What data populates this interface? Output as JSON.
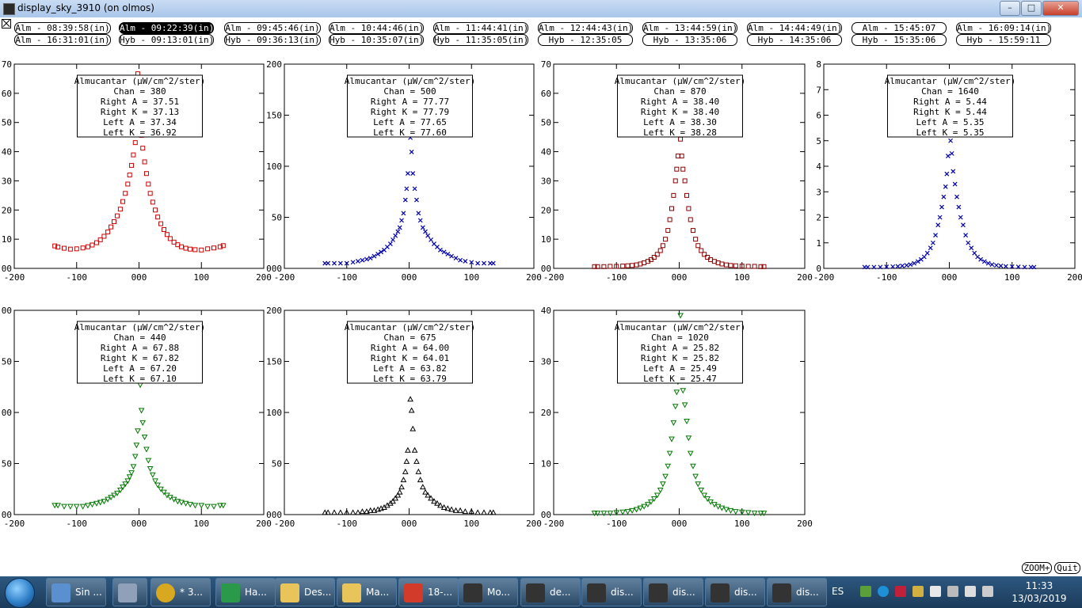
{
  "window": {
    "title": "display_sky_3910 (on olmos)"
  },
  "time_buttons": [
    [
      "Alm - 08:39:58(in)",
      "Alm - 09:22:39(in)",
      "Alm - 09:45:46(in)",
      "Alm - 10:44:46(in)",
      "Alm - 11:44:41(in)",
      "Alm - 12:44:43(in)",
      "Alm - 13:44:59(in)",
      "Alm - 14:44:49(in)",
      "Alm - 15:45:07",
      "Alm - 16:09:14(in)"
    ],
    [
      "Alm - 16:31:01(in)",
      "Hyb - 09:13:01(in)",
      "Hyb - 09:36:13(in)",
      "Hyb - 10:35:07(in)",
      "Hyb - 11:35:05(in)",
      "Hyb - 12:35:05",
      "Hyb - 13:35:06",
      "Hyb - 14:35:06",
      "Hyb - 15:35:06",
      "Hyb - 15:59:11"
    ]
  ],
  "selected_button": "Alm - 09:22:39(in)",
  "bottom_buttons": {
    "zoom": "ZOOM+",
    "quit": "Quit"
  },
  "colors": {
    "red": "#cc0000",
    "blue": "#0000aa",
    "darkred": "#8b0000",
    "green": "#007700",
    "black": "#000000"
  },
  "chart_data": [
    {
      "type": "scatter",
      "marker": "square",
      "color": "#cc0000",
      "xlim": [
        -200,
        200
      ],
      "ylim": [
        0,
        70
      ],
      "yticks": [
        "00",
        "10",
        "20",
        "30",
        "40",
        "50",
        "60",
        "70"
      ],
      "xticks": [
        "-200",
        "-100",
        "000",
        "100",
        "200"
      ],
      "legend": [
        "Almucantar (µW/cm^2/ster)",
        "Chan = 380",
        "Right A = 37.51",
        "Right K = 37.13",
        "Left A = 37.34",
        "Left K = 36.92"
      ],
      "x": [
        -135,
        -130,
        -120,
        -110,
        -100,
        -90,
        -82,
        -75,
        -68,
        -62,
        -56,
        -50,
        -45,
        -40,
        -35,
        -30,
        -26,
        -22,
        -18,
        -15,
        -12,
        -9,
        -6,
        -4,
        -2,
        2,
        4,
        6,
        9,
        12,
        15,
        18,
        22,
        26,
        30,
        35,
        40,
        45,
        50,
        56,
        62,
        68,
        75,
        82,
        90,
        100,
        110,
        120,
        130,
        135
      ],
      "y": [
        7.7,
        7.3,
        6.9,
        6.6,
        6.7,
        7.0,
        7.4,
        8.0,
        8.8,
        9.8,
        11.0,
        12.5,
        14.2,
        16.0,
        18.0,
        20.3,
        22.9,
        25.7,
        28.9,
        32.0,
        35.3,
        38.9,
        43.1,
        49.0,
        66.7,
        64.5,
        45.6,
        41.2,
        36.5,
        32.5,
        28.9,
        25.7,
        22.7,
        20.0,
        17.6,
        15.3,
        13.3,
        11.6,
        10.2,
        9.0,
        8.1,
        7.4,
        6.9,
        6.6,
        6.4,
        6.3,
        6.7,
        7.0,
        7.4,
        7.8
      ]
    },
    {
      "type": "scatter",
      "marker": "x",
      "color": "#0000aa",
      "xlim": [
        -200,
        200
      ],
      "ylim": [
        0,
        200
      ],
      "yticks": [
        "000",
        "50",
        "100",
        "150",
        "200"
      ],
      "xticks": [
        "-200",
        "-100",
        "000",
        "100",
        "200"
      ],
      "legend": [
        "Almucantar (µW/cm^2/ster)",
        "Chan = 500",
        "Right A = 77.77",
        "Right K = 77.79",
        "Left A = 77.65",
        "Left K = 77.60"
      ],
      "x": [
        -135,
        -130,
        -120,
        -110,
        -100,
        -90,
        -82,
        -75,
        -68,
        -62,
        -56,
        -50,
        -45,
        -40,
        -35,
        -30,
        -26,
        -22,
        -18,
        -15,
        -12,
        -9,
        -6,
        -4,
        -2,
        2,
        4,
        6,
        9,
        12,
        15,
        18,
        22,
        26,
        30,
        35,
        40,
        45,
        50,
        56,
        62,
        68,
        75,
        82,
        90,
        100,
        110,
        120,
        130,
        135
      ],
      "y": [
        5,
        5,
        5,
        5,
        5,
        6,
        7,
        8,
        9,
        10,
        12,
        14,
        16,
        18,
        21,
        24,
        28,
        32,
        36,
        40,
        47,
        54,
        67,
        78,
        93,
        128,
        114,
        93,
        78,
        67,
        54,
        47,
        40,
        36,
        32,
        28,
        24,
        21,
        18,
        16,
        14,
        12,
        10,
        8,
        7,
        6,
        5,
        5,
        5,
        5
      ]
    },
    {
      "type": "scatter",
      "marker": "square",
      "color": "#8b0000",
      "xlim": [
        -200,
        200
      ],
      "ylim": [
        0,
        70
      ],
      "yticks": [
        "00",
        "10",
        "20",
        "30",
        "40",
        "50",
        "60",
        "70"
      ],
      "xticks": [
        "-200",
        "-100",
        "000",
        "100",
        "200"
      ],
      "legend": [
        "Almucantar (µW/cm^2/ster)",
        "Chan = 870",
        "Right A = 38.40",
        "Right K = 38.40",
        "Left A = 38.30",
        "Left K = 38.28"
      ],
      "x": [
        -135,
        -130,
        -120,
        -110,
        -100,
        -90,
        -82,
        -75,
        -68,
        -62,
        -56,
        -50,
        -45,
        -40,
        -35,
        -30,
        -26,
        -22,
        -18,
        -15,
        -12,
        -9,
        -6,
        -4,
        -2,
        2,
        4,
        6,
        9,
        12,
        15,
        18,
        22,
        26,
        30,
        35,
        40,
        45,
        50,
        56,
        62,
        68,
        75,
        82,
        90,
        100,
        110,
        120,
        130,
        135
      ],
      "y": [
        0.6,
        0.6,
        0.6,
        0.7,
        0.7,
        0.8,
        0.9,
        1.0,
        1.2,
        1.5,
        1.9,
        2.4,
        3.0,
        3.8,
        4.8,
        6.1,
        7.8,
        10.0,
        13.0,
        16.7,
        20.5,
        25.0,
        30.0,
        34.0,
        38.5,
        44.3,
        38.5,
        34.0,
        30.0,
        25.0,
        20.5,
        16.7,
        13.0,
        10.0,
        7.8,
        6.1,
        4.8,
        3.8,
        3.0,
        2.4,
        1.9,
        1.5,
        1.2,
        1.0,
        0.9,
        0.8,
        0.7,
        0.7,
        0.6,
        0.6
      ]
    },
    {
      "type": "scatter",
      "marker": "x",
      "color": "#0000aa",
      "xlim": [
        -200,
        200
      ],
      "ylim": [
        0,
        8
      ],
      "yticks": [
        "0",
        "1",
        "2",
        "3",
        "4",
        "5",
        "6",
        "7",
        "8"
      ],
      "xticks": [
        "-200",
        "-100",
        "000",
        "100",
        "200"
      ],
      "legend": [
        "Almucantar (µW/cm^2/ster)",
        "Chan = 1640",
        "Right A = 5.44",
        "Right K = 5.44",
        "Left A = 5.35",
        "Left K = 5.35"
      ],
      "x": [
        -135,
        -130,
        -120,
        -110,
        -100,
        -90,
        -82,
        -75,
        -68,
        -62,
        -56,
        -50,
        -45,
        -40,
        -35,
        -30,
        -26,
        -22,
        -18,
        -15,
        -12,
        -9,
        -6,
        -4,
        -2,
        2,
        4,
        6,
        9,
        12,
        15,
        18,
        22,
        26,
        30,
        35,
        40,
        45,
        50,
        56,
        62,
        68,
        75,
        82,
        90,
        100,
        110,
        120,
        130,
        135
      ],
      "y": [
        0.05,
        0.05,
        0.05,
        0.05,
        0.06,
        0.07,
        0.08,
        0.1,
        0.12,
        0.15,
        0.2,
        0.27,
        0.35,
        0.45,
        0.6,
        0.8,
        1.0,
        1.3,
        1.7,
        2.0,
        2.4,
        2.8,
        3.2,
        3.7,
        4.4,
        5.0,
        4.5,
        3.8,
        3.3,
        2.8,
        2.4,
        2.0,
        1.7,
        1.3,
        1.0,
        0.8,
        0.6,
        0.45,
        0.35,
        0.27,
        0.2,
        0.15,
        0.12,
        0.1,
        0.08,
        0.07,
        0.06,
        0.05,
        0.05,
        0.05
      ]
    },
    {
      "type": "scatter",
      "marker": "triangle-down",
      "color": "#007700",
      "xlim": [
        -200,
        200
      ],
      "ylim": [
        0,
        200
      ],
      "yticks": [
        "00",
        "50",
        "00",
        "50",
        "00"
      ],
      "xticks": [
        "-200",
        "-100",
        "000",
        "100",
        "200"
      ],
      "legend": [
        "Almucantar (µW/cm^2/ster)",
        "Chan = 440",
        "Right A = 67.88",
        "Right K = 67.82",
        "Left A = 67.20",
        "Left K = 67.10"
      ],
      "x": [
        -135,
        -130,
        -120,
        -110,
        -100,
        -90,
        -82,
        -75,
        -68,
        -62,
        -56,
        -50,
        -45,
        -40,
        -35,
        -30,
        -26,
        -22,
        -18,
        -15,
        -12,
        -9,
        -6,
        -4,
        -2,
        2,
        4,
        6,
        9,
        12,
        15,
        18,
        22,
        26,
        30,
        35,
        40,
        45,
        50,
        56,
        62,
        68,
        75,
        82,
        90,
        100,
        110,
        120,
        130,
        135
      ],
      "y": [
        9,
        9,
        8,
        8,
        8,
        8,
        9,
        10,
        11,
        12,
        13,
        15,
        17,
        19,
        21,
        24,
        27,
        30,
        33,
        37,
        41,
        47,
        57,
        68,
        82,
        127,
        102,
        90,
        76,
        64,
        53,
        45,
        39,
        33,
        29,
        25,
        22,
        19,
        17,
        15,
        13,
        12,
        11,
        10,
        9,
        9,
        8,
        8,
        9,
        9
      ]
    },
    {
      "type": "scatter",
      "marker": "triangle-up",
      "color": "#000000",
      "xlim": [
        -200,
        200
      ],
      "ylim": [
        0,
        200
      ],
      "yticks": [
        "000",
        "50",
        "100",
        "150",
        "200"
      ],
      "xticks": [
        "-200",
        "-100",
        "000",
        "100",
        "200"
      ],
      "legend": [
        "Almucantar (µW/cm^2/ster)",
        "Chan = 675",
        "Right A = 64.00",
        "Right K = 64.01",
        "Left A = 63.82",
        "Left K = 63.79"
      ],
      "x": [
        -135,
        -130,
        -120,
        -110,
        -100,
        -90,
        -82,
        -75,
        -68,
        -62,
        -56,
        -50,
        -45,
        -40,
        -35,
        -30,
        -26,
        -22,
        -18,
        -15,
        -12,
        -9,
        -6,
        -4,
        -2,
        2,
        4,
        6,
        9,
        12,
        15,
        18,
        22,
        26,
        30,
        35,
        40,
        45,
        50,
        56,
        62,
        68,
        75,
        82,
        90,
        100,
        110,
        120,
        130,
        135
      ],
      "y": [
        2,
        2,
        2,
        2,
        2,
        2,
        2,
        3,
        3,
        4,
        4,
        5,
        6,
        7,
        9,
        11,
        13,
        16,
        19,
        22,
        27,
        34,
        42,
        52,
        63,
        113,
        102,
        84,
        63,
        52,
        42,
        34,
        27,
        22,
        19,
        16,
        13,
        11,
        9,
        7,
        6,
        5,
        4,
        4,
        3,
        3,
        2,
        2,
        2,
        2
      ]
    },
    {
      "type": "scatter",
      "marker": "triangle-down",
      "color": "#007700",
      "xlim": [
        -200,
        200
      ],
      "ylim": [
        0,
        40
      ],
      "yticks": [
        "00",
        "10",
        "20",
        "30",
        "40"
      ],
      "xticks": [
        "-200",
        "-100",
        "000",
        "100",
        "200"
      ],
      "legend": [
        "Almucantar (µW/cm^2/ster)",
        "Chan = 1020",
        "Right A = 25.82",
        "Right K = 25.82",
        "Left A = 25.49",
        "Left K = 25.47"
      ],
      "x": [
        -135,
        -130,
        -120,
        -110,
        -100,
        -90,
        -82,
        -75,
        -68,
        -62,
        -56,
        -50,
        -45,
        -40,
        -35,
        -30,
        -26,
        -22,
        -18,
        -15,
        -12,
        -9,
        -6,
        -4,
        -2,
        2,
        4,
        6,
        9,
        12,
        15,
        18,
        22,
        26,
        30,
        35,
        40,
        45,
        50,
        56,
        62,
        68,
        75,
        82,
        90,
        100,
        110,
        120,
        130,
        135
      ],
      "y": [
        0.3,
        0.3,
        0.3,
        0.3,
        0.4,
        0.5,
        0.6,
        0.8,
        1.0,
        1.3,
        1.6,
        2.0,
        2.5,
        3.1,
        3.8,
        4.8,
        6.0,
        7.5,
        9.5,
        12.0,
        14.8,
        18.0,
        21.2,
        24.0,
        26.0,
        39.0,
        26.5,
        24.3,
        21.5,
        18.3,
        15.0,
        12.0,
        9.5,
        7.5,
        6.0,
        4.8,
        3.8,
        3.1,
        2.5,
        2.0,
        1.6,
        1.3,
        1.0,
        0.8,
        0.6,
        0.5,
        0.4,
        0.3,
        0.3,
        0.3
      ]
    }
  ],
  "taskbar": {
    "items": [
      {
        "label": "Sin ...",
        "icon": "notepad-icon"
      },
      {
        "label": "",
        "icon": "calculator-icon"
      },
      {
        "label": "* 3...",
        "icon": "chrome-icon"
      },
      {
        "label": "Ha...",
        "icon": "hangouts-icon"
      },
      {
        "label": "Des...",
        "icon": "folder-icon"
      },
      {
        "label": "Ma...",
        "icon": "folder-icon"
      },
      {
        "label": "18-...",
        "icon": "pdf-icon"
      },
      {
        "label": "Mo...",
        "icon": "xwin-icon"
      },
      {
        "label": "de...",
        "icon": "xwin-icon"
      },
      {
        "label": "dis...",
        "icon": "xwin-icon"
      },
      {
        "label": "dis...",
        "icon": "xwin-icon"
      },
      {
        "label": "dis...",
        "icon": "xwin-icon"
      },
      {
        "label": "dis...",
        "icon": "xwin-icon"
      }
    ],
    "language": "ES",
    "time": "11:33",
    "date": "13/03/2019"
  }
}
